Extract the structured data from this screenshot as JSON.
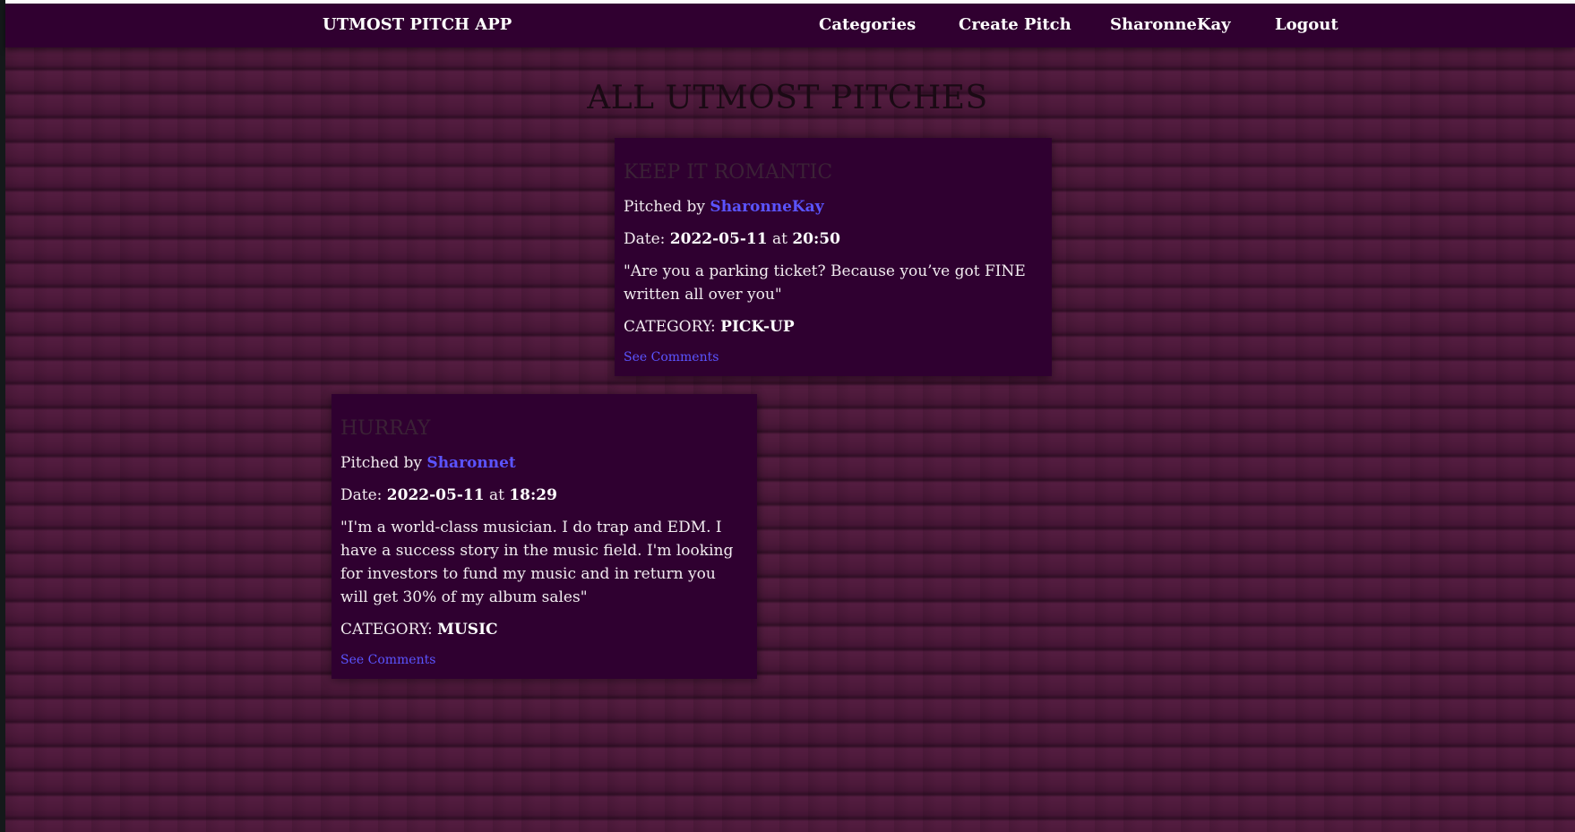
{
  "nav": {
    "brand": "UTMOST PITCH APP",
    "categories": "Categories",
    "create_pitch": "Create Pitch",
    "user": "SharonneKay",
    "logout": "Logout"
  },
  "page": {
    "title": "ALL UTMOST PITCHES"
  },
  "pitches": [
    {
      "title": "KEEP IT ROMANTIC",
      "pitched_by_label": "Pitched by",
      "author": "SharonneKay",
      "date_label": "Date:",
      "date": "2022-05-11",
      "at_label": "at",
      "time": "20:50",
      "body": "\"Are you a parking ticket? Because you’ve got FINE written all over you\"",
      "category_label": "CATEGORY:",
      "category": "PICK-UP",
      "comments_link": "See Comments"
    },
    {
      "title": "HURRAY",
      "pitched_by_label": "Pitched by",
      "author": "Sharonnet",
      "date_label": "Date:",
      "date": "2022-05-11",
      "at_label": "at",
      "time": "18:29",
      "body": "\"I'm a world-class musician. I do trap and EDM. I have a success story in the music field. I'm looking for investors to fund my music and in return you will get 30% of my album sales\"",
      "category_label": "CATEGORY:",
      "category": "MUSIC",
      "comments_link": "See Comments"
    }
  ],
  "colors": {
    "navbar": "#300030",
    "card": "#2f0030",
    "background": "#8b4f78",
    "link": "#5b54ff"
  }
}
